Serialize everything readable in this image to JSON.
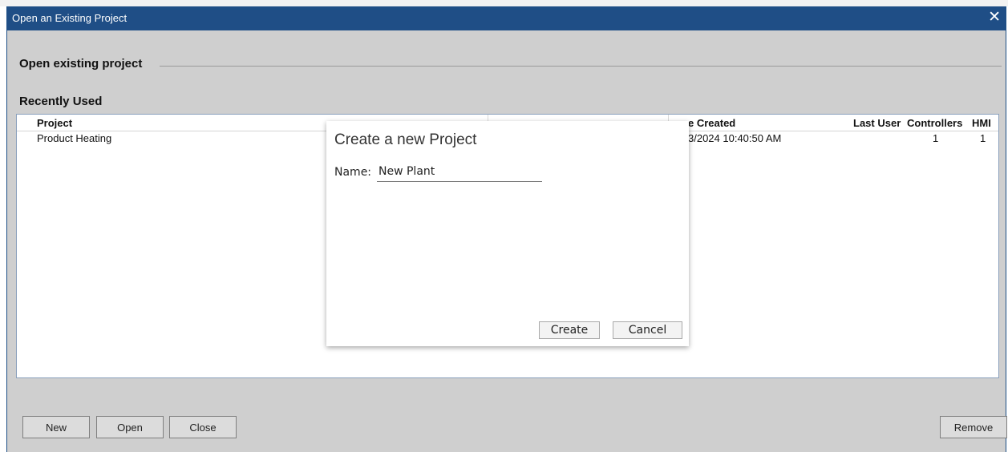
{
  "window": {
    "title": "Open an Existing Project",
    "close_glyph": "✕",
    "section_open": "Open existing project",
    "section_recent": "Recently Used"
  },
  "table": {
    "columns": [
      "Project",
      "e Created",
      "Last User",
      "Controllers",
      "HMI"
    ],
    "rows": [
      {
        "project": "Product Heating",
        "created": "3/2024 10:40:50 AM",
        "last_user": "",
        "controllers": "1",
        "hmi": "1"
      }
    ]
  },
  "modal": {
    "title": "Create a new Project",
    "name_label": "Name:",
    "name_value": "New Plant",
    "create_label": "Create",
    "cancel_label": "Cancel"
  },
  "buttons": {
    "new": "New",
    "open": "Open",
    "close": "Close",
    "remove": "Remove"
  },
  "colors": {
    "titlebar": "#1f4e86",
    "window_bg": "#cfcfcf"
  }
}
